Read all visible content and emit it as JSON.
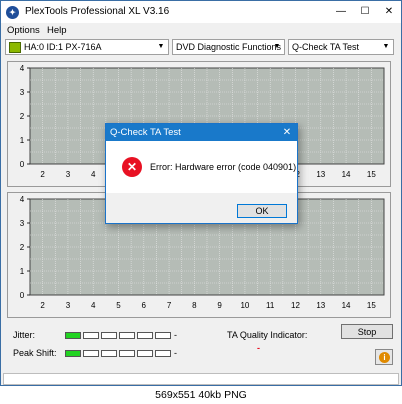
{
  "window": {
    "title": "PlexTools Professional XL V3.16",
    "minimize": "—",
    "maximize": "☐",
    "close": "✕"
  },
  "menu": [
    "Options",
    "Help"
  ],
  "toolbar": {
    "drive": "HA:0 ID:1  PX-716A",
    "function": "DVD Diagnostic Functions",
    "test": "Q-Check  TA Test"
  },
  "charts": {
    "x_ticks": [
      "2",
      "3",
      "4",
      "5",
      "6",
      "7",
      "8",
      "9",
      "10",
      "11",
      "12",
      "13",
      "14",
      "15"
    ],
    "y_ticks": [
      "0",
      "1",
      "2",
      "3",
      "4"
    ]
  },
  "chart_data": [
    {
      "type": "line",
      "x": [],
      "series": [],
      "xlim": [
        1.5,
        15.5
      ],
      "ylim": [
        0,
        4
      ],
      "grid": true
    },
    {
      "type": "line",
      "x": [],
      "series": [],
      "xlim": [
        1.5,
        15.5
      ],
      "ylim": [
        0,
        4
      ],
      "grid": true
    }
  ],
  "bottom": {
    "jitter_label": "Jitter:",
    "peak_shift_label": "Peak Shift:",
    "jitter_value": "-",
    "peak_shift_value": "-",
    "jitter_cells_on": 1,
    "peak_shift_cells_on": 1,
    "cells_total": 6,
    "ta_label": "TA Quality Indicator:",
    "ta_value": "-",
    "stop_label": "Stop",
    "info_icon": "i"
  },
  "dialog": {
    "title": "Q-Check TA Test",
    "close": "✕",
    "icon": "✕",
    "message": "Error: Hardware error (code 040901)",
    "ok": "OK"
  },
  "caption": "569x551  40kb  PNG",
  "colors": {
    "plot_bg": "#b5bcb6",
    "meter_on": "#22d322",
    "dialog_title_bg": "#1979ca",
    "ta_value": "#e81123"
  }
}
